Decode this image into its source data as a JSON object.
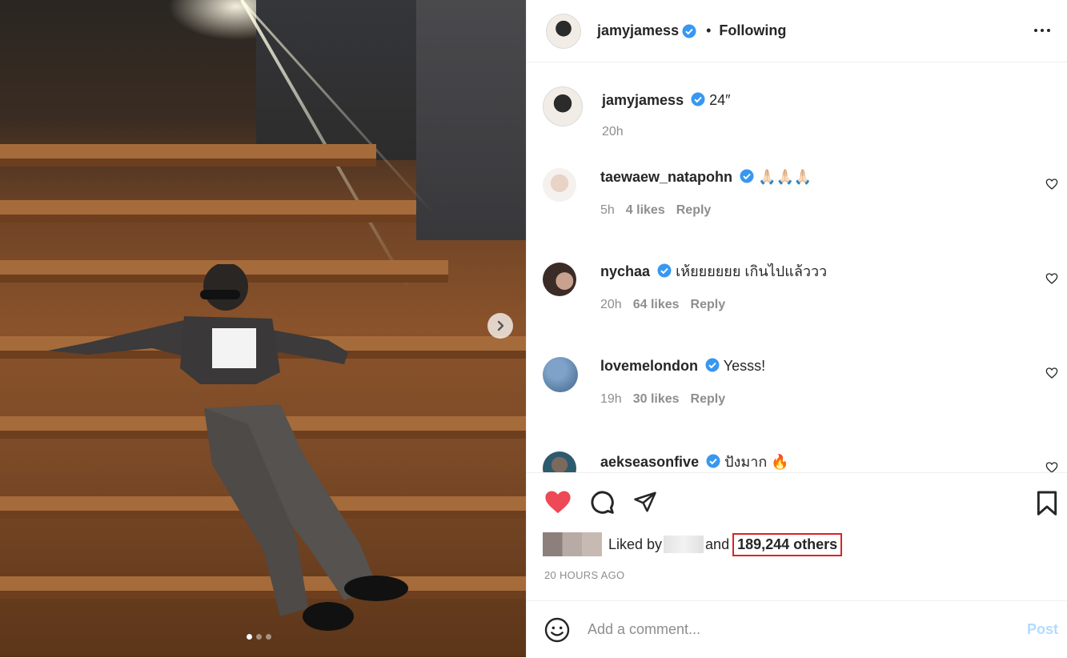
{
  "post": {
    "username": "jamyjamess",
    "following_label": "Following",
    "separator": "•",
    "caption": "24″",
    "caption_time": "20h"
  },
  "comments": [
    {
      "user": "taewaew_natapohn",
      "text": "🙏🏻🙏🏻🙏🏻",
      "time": "5h",
      "likes": "4 likes",
      "reply": "Reply"
    },
    {
      "user": "nychaa",
      "text": "เห้ยยยยยย เกินไปแล้ววว",
      "time": "20h",
      "likes": "64 likes",
      "reply": "Reply"
    },
    {
      "user": "lovemelondon",
      "text": "Yesss!",
      "time": "19h",
      "likes": "30 likes",
      "reply": "Reply"
    },
    {
      "user": "aekseasonfive",
      "text": "ปังมาก 🔥",
      "time": "",
      "likes": "",
      "reply": ""
    }
  ],
  "likes": {
    "prefix": "Liked by",
    "and": "and",
    "others": "189,244 others"
  },
  "timestamp": "20 HOURS AGO",
  "add_comment": {
    "placeholder": "Add a comment...",
    "post_label": "Post"
  },
  "colors": {
    "verified": "#3897f0",
    "like_red": "#ed4956",
    "highlight_border": "#dd2222",
    "post_disabled": "#b3dbff"
  },
  "icons": [
    "verified-icon",
    "more-icon",
    "heart-icon",
    "comment-icon",
    "share-icon",
    "bookmark-icon",
    "emoji-icon",
    "chevron-right-icon"
  ]
}
